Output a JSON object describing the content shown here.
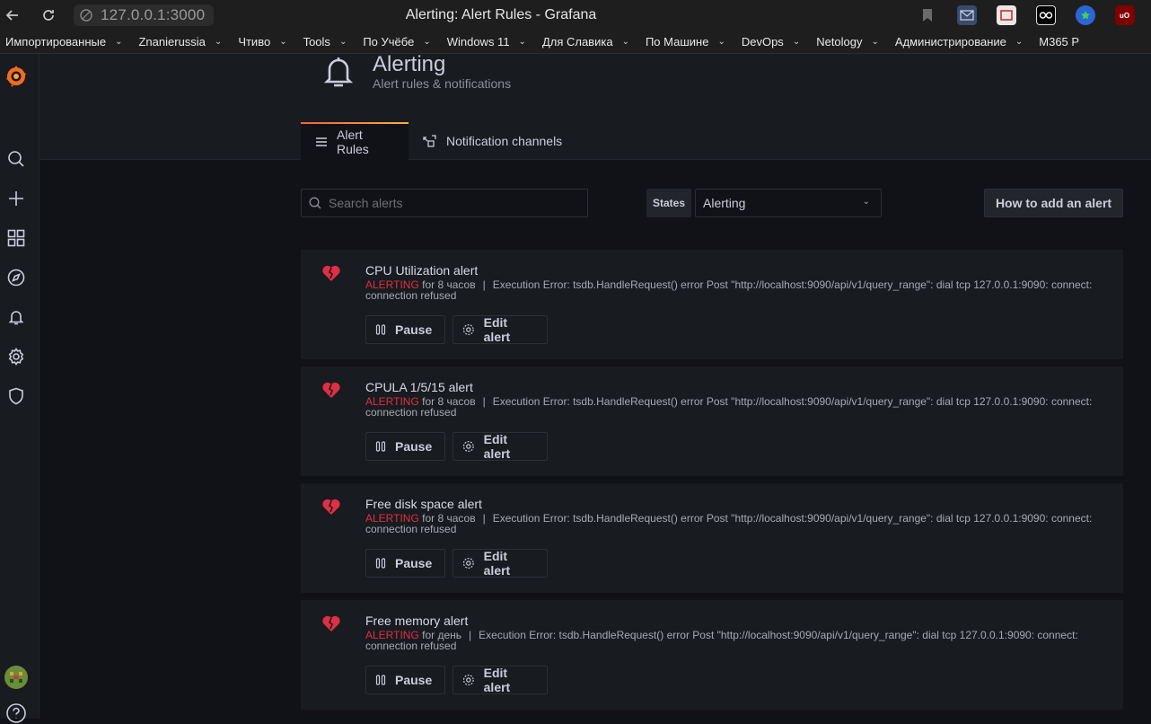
{
  "browser": {
    "url": "127.0.0.1:3000",
    "window_title": "Alerting: Alert Rules - Grafana",
    "bookmarks": [
      {
        "label": "Импортированные"
      },
      {
        "label": "Znanierussia"
      },
      {
        "label": "Чтиво"
      },
      {
        "label": "Tools"
      },
      {
        "label": "По Учёбе"
      },
      {
        "label": "Windows 11"
      },
      {
        "label": "Для Славика"
      },
      {
        "label": "По Машине"
      },
      {
        "label": "DevOps"
      },
      {
        "label": "Netology"
      },
      {
        "label": "Администрирование"
      },
      {
        "label": "M365 P"
      }
    ]
  },
  "sidemenu": {
    "items": [
      "grafana-logo-icon",
      "search-icon",
      "plus-icon",
      "dashboards-icon",
      "explore-icon",
      "bell-icon",
      "gear-icon",
      "shield-icon",
      "avatar",
      "help-icon"
    ]
  },
  "header": {
    "title": "Alerting",
    "subtitle": "Alert rules & notifications",
    "tabs": [
      {
        "label": "Alert Rules",
        "active": true
      },
      {
        "label": "Notification channels",
        "active": false
      }
    ]
  },
  "controls": {
    "search_placeholder": "Search alerts",
    "states_label": "States",
    "states_value": "Alerting",
    "howto_label": "How to add an alert"
  },
  "alerts": [
    {
      "name": "CPU Utilization alert",
      "state": "ALERTING",
      "duration": "for 8 часов",
      "message": "Execution Error: tsdb.HandleRequest() error Post \"http://localhost:9090/api/v1/query_range\": dial tcp 127.0.0.1:9090: connect: connection refused",
      "pause_label": "Pause",
      "edit_label": "Edit alert"
    },
    {
      "name": "CPULA 1/5/15 alert",
      "state": "ALERTING",
      "duration": "for 8 часов",
      "message": "Execution Error: tsdb.HandleRequest() error Post \"http://localhost:9090/api/v1/query_range\": dial tcp 127.0.0.1:9090: connect: connection refused",
      "pause_label": "Pause",
      "edit_label": "Edit alert"
    },
    {
      "name": "Free disk space alert",
      "state": "ALERTING",
      "duration": "for 8 часов",
      "message": "Execution Error: tsdb.HandleRequest() error Post \"http://localhost:9090/api/v1/query_range\": dial tcp 127.0.0.1:9090: connect: connection refused",
      "pause_label": "Pause",
      "edit_label": "Edit alert"
    },
    {
      "name": "Free memory alert",
      "state": "ALERTING",
      "duration": "for день",
      "message": "Execution Error: tsdb.HandleRequest() error Post \"http://localhost:9090/api/v1/query_range\": dial tcp 127.0.0.1:9090: connect: connection refused",
      "pause_label": "Pause",
      "edit_label": "Edit alert"
    }
  ],
  "colors": {
    "alerting": "#e02f44",
    "background": "#111217",
    "panel": "#181b1f",
    "accent_start": "#f55f3e",
    "accent_end": "#ffad3e"
  }
}
